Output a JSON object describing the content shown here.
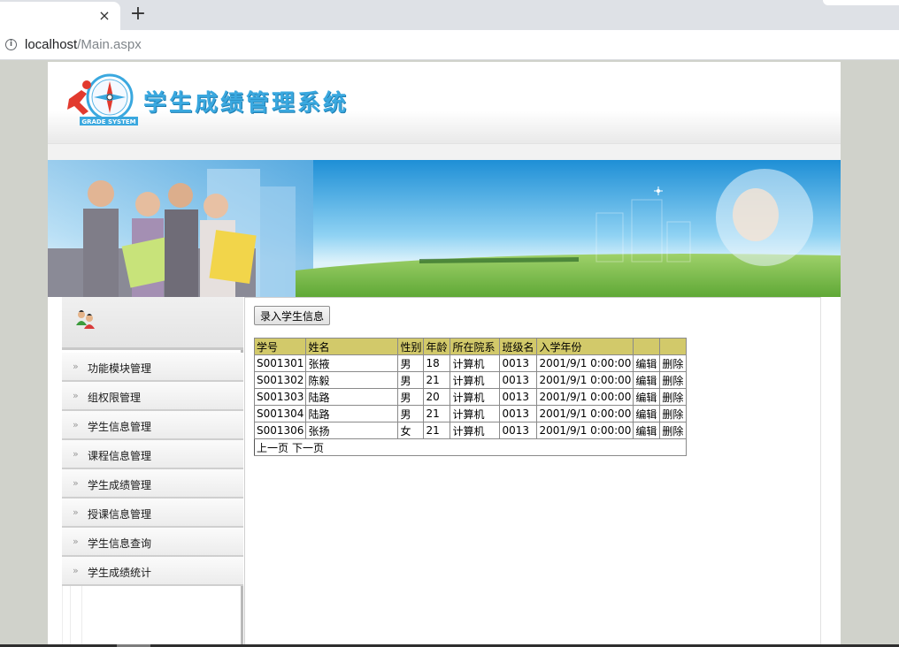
{
  "browser": {
    "tab_close": "×",
    "new_tab": "+",
    "url_host": "localhost",
    "url_path": "/Main.aspx"
  },
  "header": {
    "system_title": "学生成绩管理系统",
    "logo_icon": "student-runner-compass-logo",
    "logo_caption": "GRADE SYSTEM"
  },
  "sidebar": {
    "header_icon": "users-icon",
    "items": [
      {
        "label": "功能模块管理"
      },
      {
        "label": "组权限管理"
      },
      {
        "label": "学生信息管理"
      },
      {
        "label": "课程信息管理"
      },
      {
        "label": "学生成绩管理"
      },
      {
        "label": "授课信息管理"
      },
      {
        "label": "学生信息查询"
      },
      {
        "label": "学生成绩统计"
      }
    ]
  },
  "main": {
    "add_button": "录入学生信息",
    "table": {
      "columns": [
        "学号",
        "姓名",
        "性别",
        "年龄",
        "所在院系",
        "班级名",
        "入学年份",
        "",
        ""
      ],
      "rows": [
        [
          "S001301",
          "张掖",
          "男",
          "18",
          "计算机",
          "0013",
          "2001/9/1 0:00:00",
          "编辑",
          "删除"
        ],
        [
          "S001302",
          "陈毅",
          "男",
          "21",
          "计算机",
          "0013",
          "2001/9/1 0:00:00",
          "编辑",
          "删除"
        ],
        [
          "S001303",
          "陆路",
          "男",
          "20",
          "计算机",
          "0013",
          "2001/9/1 0:00:00",
          "编辑",
          "删除"
        ],
        [
          "S001304",
          "陆路",
          "男",
          "21",
          "计算机",
          "0013",
          "2001/9/1 0:00:00",
          "编辑",
          "删除"
        ],
        [
          "S001306",
          "张扬",
          "女",
          "21",
          "计算机",
          "0013",
          "2001/9/1 0:00:00",
          "编辑",
          "删除"
        ]
      ]
    },
    "pager": {
      "prev": "上一页",
      "next": "下一页"
    }
  },
  "colors": {
    "header_accent": "#3aa8df",
    "table_header": "#d2c96a",
    "outer_background": "#d0d2cb"
  }
}
